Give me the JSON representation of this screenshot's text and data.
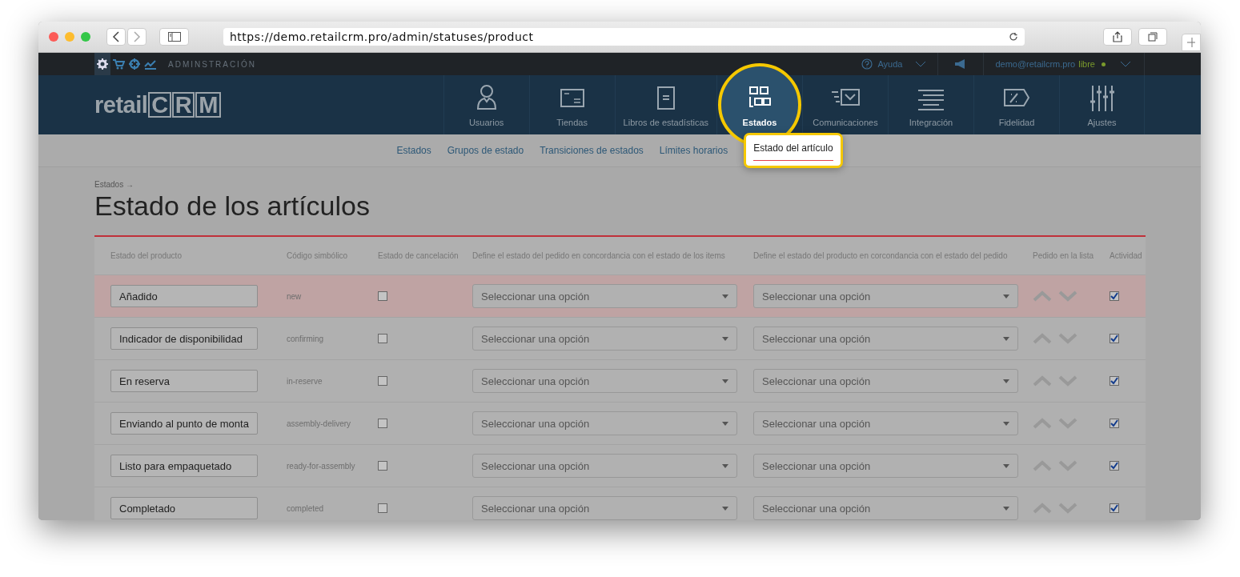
{
  "browser": {
    "url": "https://demo.retailcrm.pro/admin/statuses/product"
  },
  "topbar": {
    "section_label": "ADMINSTRACIÓN",
    "tools": [
      {
        "kind": "gear",
        "selected": true
      },
      {
        "kind": "cart",
        "selected": false
      },
      {
        "kind": "target",
        "selected": false
      },
      {
        "kind": "chart",
        "selected": false
      }
    ],
    "help": "Ayuda",
    "user": "demo@retailcrm.pro",
    "plan": "libre"
  },
  "header": {
    "logo_prefix": "retail",
    "logo_letters": [
      "C",
      "R",
      "M"
    ],
    "nav": [
      {
        "label": "Usuarios",
        "selected": false
      },
      {
        "label": "Tiendas",
        "selected": false
      },
      {
        "label": "Libros de estadísticas",
        "selected": false
      },
      {
        "label": "Estados",
        "selected": true
      },
      {
        "label": "Comunicaciones",
        "selected": false
      },
      {
        "label": "Integración",
        "selected": false
      },
      {
        "label": "Fidelidad",
        "selected": false
      },
      {
        "label": "Ajustes",
        "selected": false
      }
    ]
  },
  "subnav": [
    {
      "label": "Estados",
      "selected": false
    },
    {
      "label": "Grupos de estado",
      "selected": false
    },
    {
      "label": "Transiciones de estados",
      "selected": false
    },
    {
      "label": "Límites horarios",
      "selected": false
    },
    {
      "label": "Estado del artículo",
      "selected": true
    }
  ],
  "breadcrumb": "Estados →",
  "title": "Estado de los artículos",
  "table": {
    "columns": [
      "Estado del producto",
      "Código simbólico",
      "Estado de cancelación",
      "Define el estado del pedido en concordancia con el estado de los items",
      "Define el estado del producto en corcondancia con el estado del pedido",
      "Pedido en la lista",
      "Actividad"
    ],
    "rows": [
      {
        "name": "Añadido",
        "code": "new",
        "cancel": false,
        "order_status": "Seleccionar una opción",
        "product_status": "Seleccionar una opción",
        "active": true,
        "highlighted": true
      },
      {
        "name": "Indicador de disponibilidad",
        "code": "confirming",
        "cancel": false,
        "order_status": "Seleccionar una opción",
        "product_status": "Seleccionar una opción",
        "active": true,
        "highlighted": false
      },
      {
        "name": "En reserva",
        "code": "in-reserve",
        "cancel": false,
        "order_status": "Seleccionar una opción",
        "product_status": "Seleccionar una opción",
        "active": true,
        "highlighted": false
      },
      {
        "name": "Enviando al punto de monta",
        "code": "assembly-delivery",
        "cancel": false,
        "order_status": "Seleccionar una opción",
        "product_status": "Seleccionar una opción",
        "active": true,
        "highlighted": false
      },
      {
        "name": "Listo para empaquetado",
        "code": "ready-for-assembly",
        "cancel": false,
        "order_status": "Seleccionar una opción",
        "product_status": "Seleccionar una opción",
        "active": true,
        "highlighted": false
      },
      {
        "name": "Completado",
        "code": "completed",
        "cancel": false,
        "order_status": "Seleccionar una opción",
        "product_status": "Seleccionar una opción",
        "active": true,
        "highlighted": false
      }
    ]
  }
}
